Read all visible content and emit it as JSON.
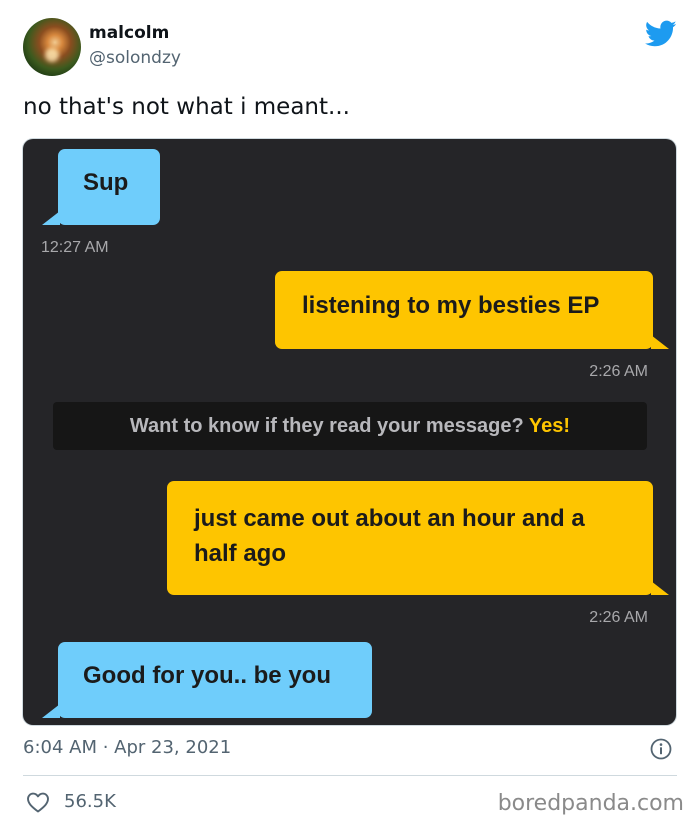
{
  "tweet": {
    "author": {
      "name": "malcolm ",
      "handle": "@solondzy"
    },
    "text": "no that's not what i meant...",
    "date": "6:04 AM · Apr 23, 2021",
    "likes": "56.5K",
    "brand_color": "#1d9bf0"
  },
  "chat": {
    "colors": {
      "background": "#252528",
      "incoming": "#6fcdfb",
      "outgoing": "#fec500"
    },
    "messages": [
      {
        "side": "incoming",
        "text": "Sup",
        "time": "12:27 AM"
      },
      {
        "side": "outgoing",
        "text": "listening to my besties EP",
        "time": "2:26 AM"
      },
      {
        "side": "outgoing",
        "text": "just came out about an hour and a half ago",
        "time": "2:26 AM"
      },
      {
        "side": "incoming",
        "text": "Good for you.. be you"
      }
    ],
    "read_receipt_prompt": {
      "text": "Want to know if they read your message?",
      "action": "Yes!"
    }
  },
  "watermark": "boredpanda.com",
  "icons": [
    "twitter-bird-icon",
    "info-icon",
    "heart-icon"
  ]
}
